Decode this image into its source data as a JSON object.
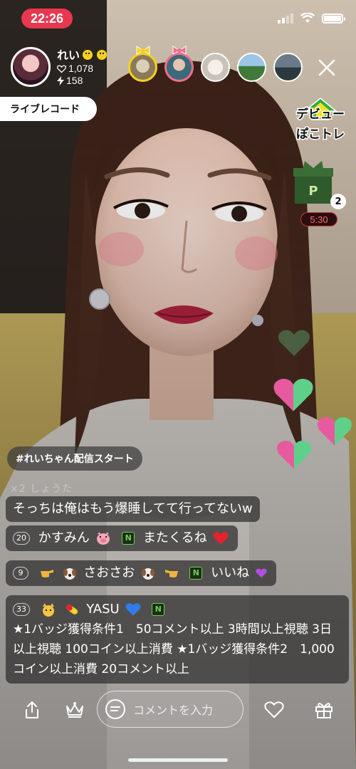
{
  "status_bar": {
    "time": "22:26"
  },
  "host": {
    "name": "れい",
    "likes": "1,078",
    "points": "158",
    "live_record_label": "ライブレコード"
  },
  "viewers": [
    {
      "name": "viewer-1"
    },
    {
      "name": "viewer-2"
    },
    {
      "name": "viewer-3"
    },
    {
      "name": "viewer-4"
    },
    {
      "name": "viewer-5"
    }
  ],
  "promo": {
    "debut_title_line1": "デビュー",
    "debut_title_line2": "ぽこトレ",
    "gift_count": "2",
    "gift_timer": "5:30"
  },
  "chat": {
    "tag_pill": "#れいちゃん配信スタート",
    "faded_line": "×2 しょうた",
    "messages": [
      {
        "level": "",
        "user": "",
        "text": "そっちは俺はもう爆睡してて行ってないw"
      },
      {
        "level": "20",
        "user": "かすみん",
        "text": "またくるね"
      },
      {
        "level": "9",
        "user": "さおさお",
        "text": "いいね"
      },
      {
        "level": "33",
        "user": "YASU",
        "text": "★1バッジ獲得条件1　50コメント以上 3時間以上視聴 3日以上視聴 100コイン以上消費 ★1バッジ獲得条件2　1,000コイン以上消費 20コメント以上"
      }
    ]
  },
  "bottom_bar": {
    "comment_placeholder": "コメントを入力"
  },
  "colors": {
    "status_time_bg": "#e8384f",
    "n_badge": "#6ad14a",
    "heart_green": "#5fd08a",
    "heart_pink": "#e85aa0"
  }
}
